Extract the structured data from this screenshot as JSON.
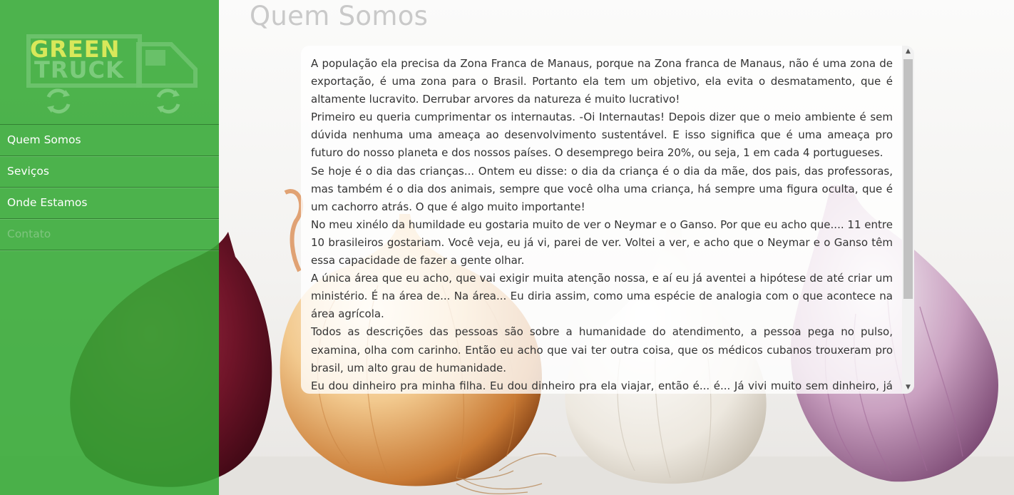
{
  "logo": {
    "line1": "GREEN",
    "line2": "TRUCK"
  },
  "nav": {
    "items": [
      {
        "label": "Quem Somos"
      },
      {
        "label": "Seviços"
      },
      {
        "label": "Onde Estamos"
      },
      {
        "label": "Contato"
      }
    ]
  },
  "page": {
    "title": "Quem Somos"
  },
  "content": {
    "paragraphs": [
      "A população ela precisa da Zona Franca de Manaus, porque na Zona franca de Manaus, não é uma zona de exportação, é uma zona para o Brasil. Portanto ela tem um objetivo, ela evita o desmatamento, que é altamente lucravito. Derrubar arvores da natureza é muito lucrativo!",
      "Primeiro eu queria cumprimentar os internautas. -Oi Internautas! Depois dizer que o meio ambiente é sem dúvida nenhuma uma ameaça ao desenvolvimento sustentável. E isso significa que é uma ameaça pro futuro do nosso planeta e dos nossos países. O desemprego beira 20%, ou seja, 1 em cada 4 portugueses.",
      "Se hoje é o dia das crianças... Ontem eu disse: o dia da criança é o dia da mãe, dos pais, das professoras, mas também é o dia dos animais, sempre que você olha uma criança, há sempre uma figura oculta, que é um cachorro atrás. O que é algo muito importante!",
      "No meu xinélo da humildade eu gostaria muito de ver o Neymar e o Ganso. Por que eu acho que.... 11 entre 10 brasileiros gostariam. Você veja, eu já vi, parei de ver. Voltei a ver, e acho que o Neymar e o Ganso têm essa capacidade de fazer a gente olhar.",
      "A única área que eu acho, que vai exigir muita atenção nossa, e aí eu já aventei a hipótese de até criar um ministério. É na área de... Na área... Eu diria assim, como uma espécie de analogia com o que acontece na área agrícola.",
      "Todos as descrições das pessoas são sobre a humanidade do atendimento, a pessoa pega no pulso, examina, olha com carinho. Então eu acho que vai ter outra coisa, que os médicos cubanos trouxeram pro brasil, um alto grau de humanidade.",
      "Eu dou dinheiro pra minha filha. Eu dou dinheiro pra ela viajar, então é... é... Já vivi muito sem dinheiro, já vivi"
    ]
  },
  "scrollbar": {
    "up_glyph": "▲",
    "down_glyph": "▼"
  }
}
